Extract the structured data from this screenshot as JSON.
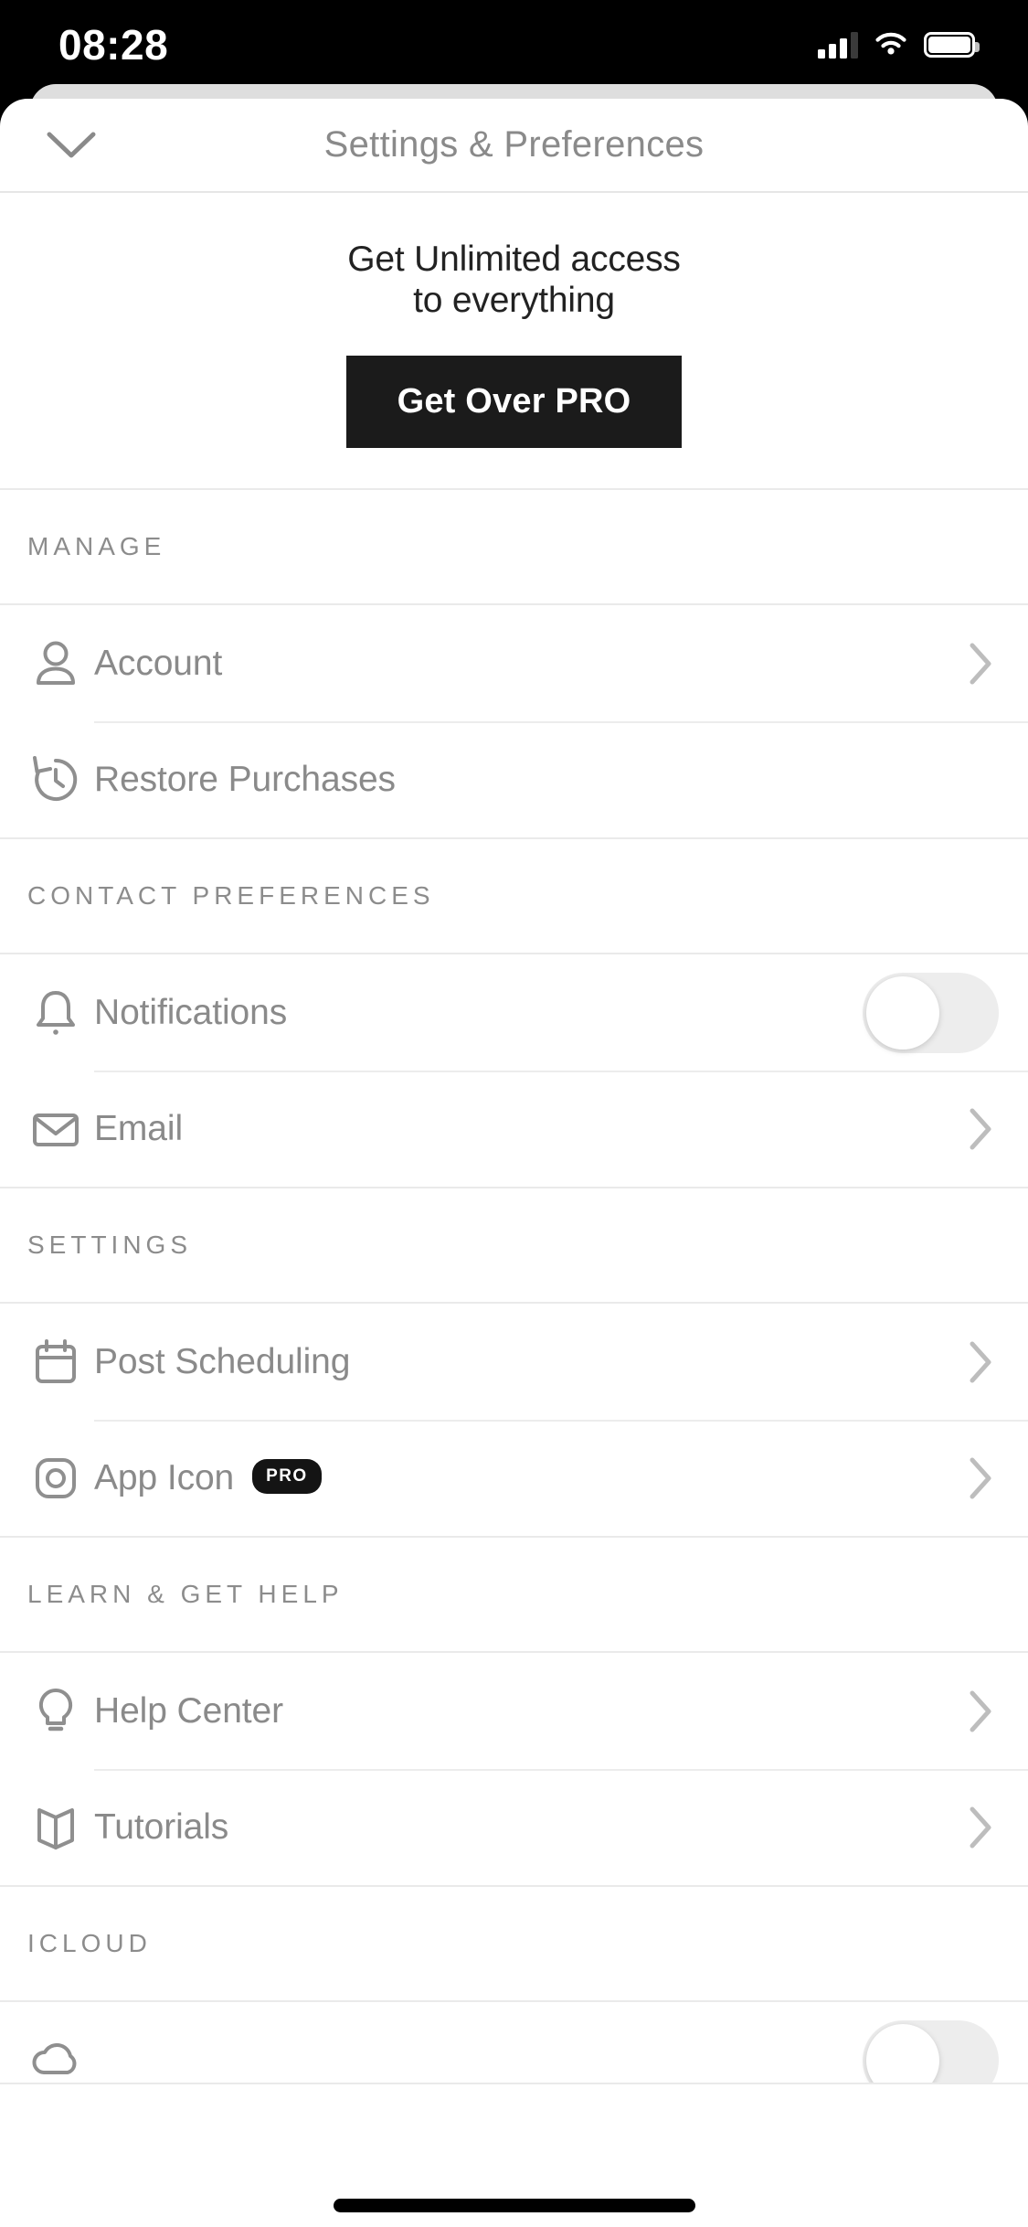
{
  "status_bar": {
    "time": "08:28",
    "signal_icon": "cellular-signal-icon",
    "wifi_icon": "wifi-icon",
    "battery_icon": "battery-icon"
  },
  "nav": {
    "back_icon": "chevron-down-icon",
    "title": "Settings & Preferences"
  },
  "promo": {
    "line1": "Get Unlimited access",
    "line2": "to everything",
    "button_label": "Get Over PRO",
    "button_bg": "#1b1b1b",
    "button_text_color": "#ffffff"
  },
  "sections": [
    {
      "title": "MANAGE",
      "rows": [
        {
          "label": "Account",
          "icon": "person-icon",
          "accessory": "chevron"
        },
        {
          "label": "Restore Purchases",
          "icon": "restore-clock-icon",
          "accessory": "none"
        }
      ]
    },
    {
      "title": "CONTACT PREFERENCES",
      "rows": [
        {
          "label": "Notifications",
          "icon": "bell-icon",
          "accessory": "toggle",
          "toggle_on": false
        },
        {
          "label": "Email",
          "icon": "envelope-icon",
          "accessory": "chevron"
        }
      ]
    },
    {
      "title": "SETTINGS",
      "rows": [
        {
          "label": "Post Scheduling",
          "icon": "calendar-icon",
          "accessory": "chevron"
        },
        {
          "label": "App Icon",
          "icon": "app-icon-square-icon",
          "accessory": "chevron",
          "badge": "PRO"
        }
      ]
    },
    {
      "title": "LEARN & GET HELP",
      "rows": [
        {
          "label": "Help Center",
          "icon": "lightbulb-icon",
          "accessory": "chevron"
        },
        {
          "label": "Tutorials",
          "icon": "book-icon",
          "accessory": "chevron"
        }
      ]
    },
    {
      "title": "ICLOUD",
      "rows": [
        {
          "label": "",
          "icon": "cloud-icon",
          "accessory": "toggle",
          "toggle_on": false
        }
      ]
    }
  ],
  "colors": {
    "label_gray": "#8a8a8a",
    "section_header_gray": "#8c8c8c",
    "divider": "#eaeaea",
    "icon_gray": "#8f8f8f",
    "toggle_off_track": "#ededed"
  }
}
